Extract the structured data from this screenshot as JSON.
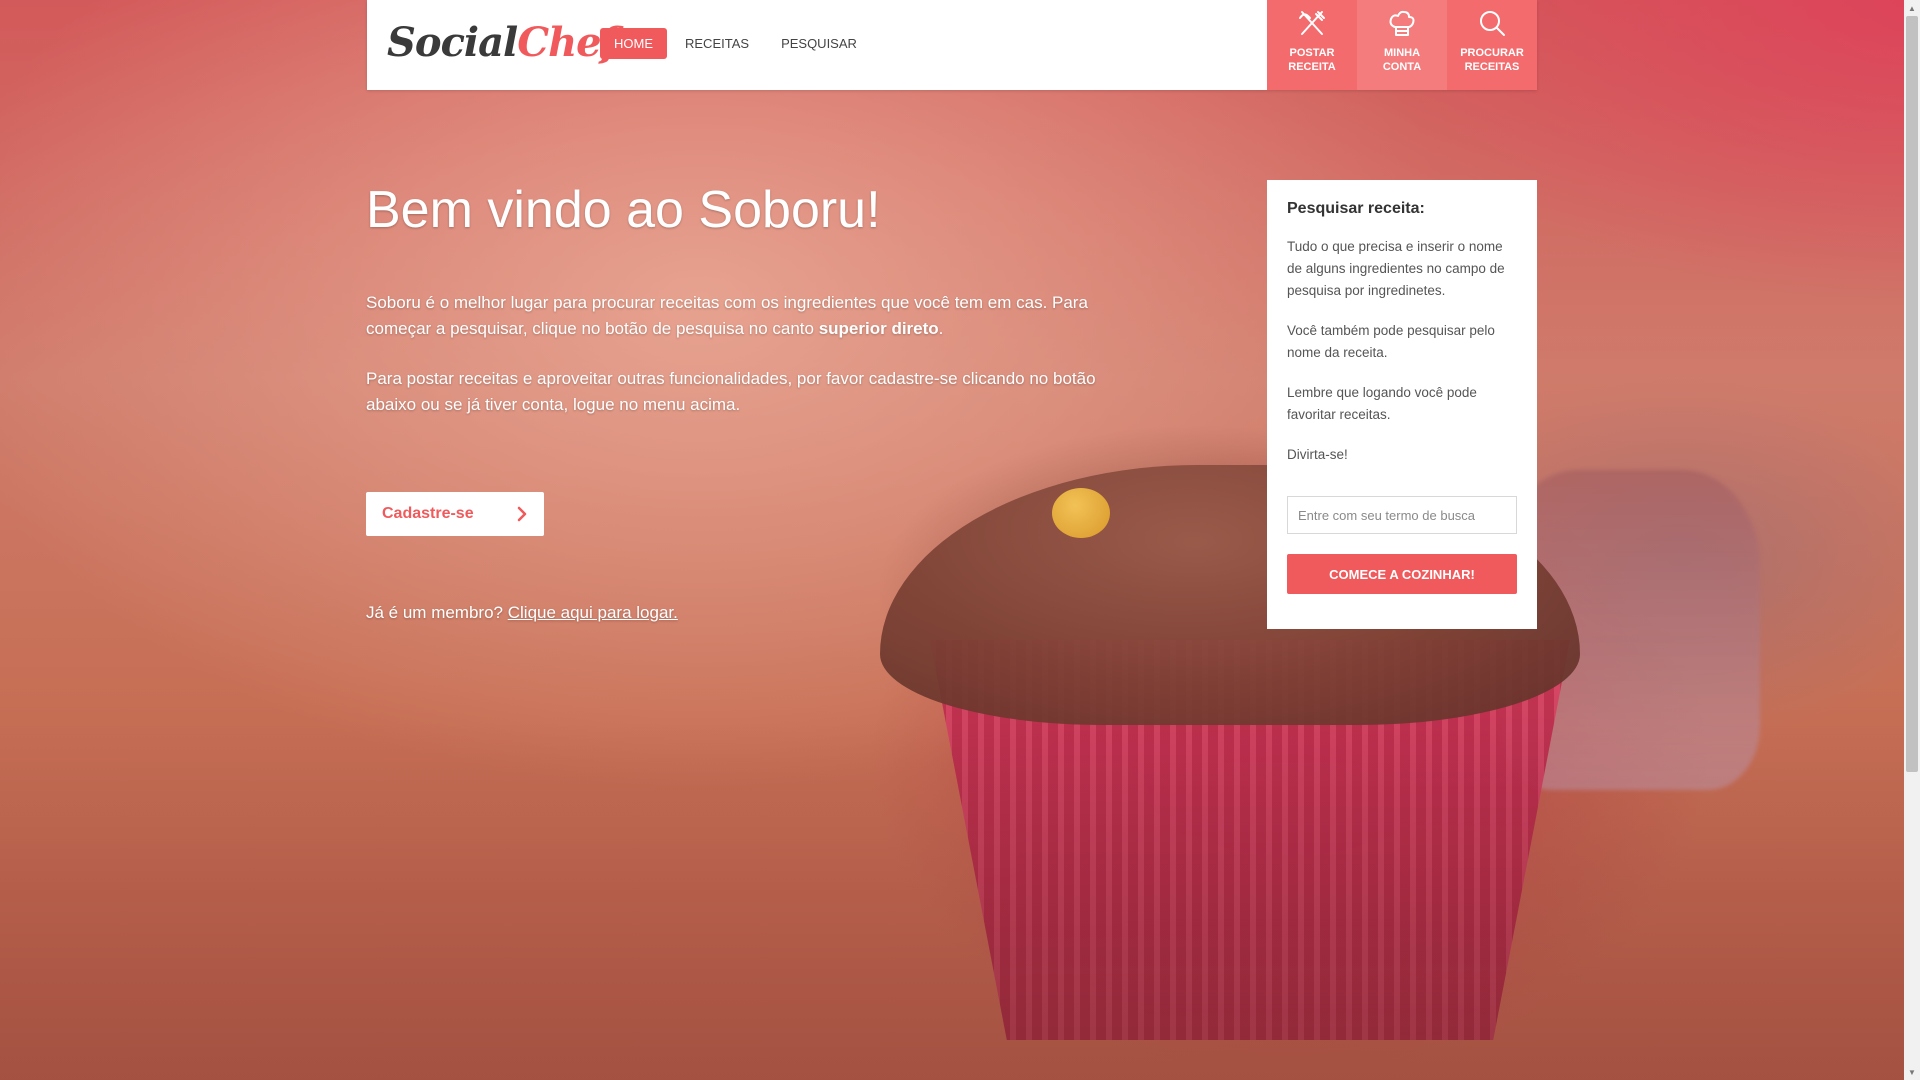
{
  "header": {
    "logo_part1": "Social",
    "logo_part2": "Chef",
    "nav": [
      {
        "label": "HOME",
        "active": true
      },
      {
        "label": "RECEITAS",
        "active": false
      },
      {
        "label": "PESQUISAR",
        "active": false
      }
    ],
    "quick_links": [
      {
        "icon": "fork-knife-icon",
        "line1": "POSTAR",
        "line2": "RECEITA"
      },
      {
        "icon": "chef-hat-icon",
        "line1": "MINHA",
        "line2": "CONTA"
      },
      {
        "icon": "search-icon",
        "line1": "PROCURAR",
        "line2": "RECEITAS"
      }
    ]
  },
  "hero": {
    "title": "Bem vindo ao Soboru!",
    "p1_start": "Soboru é o melhor lugar para procurar receitas com os ingredientes que você tem em cas. Para começar a pesquisar, clique no botão de pesquisa no canto ",
    "p1_bold": "superior direto",
    "p1_end": ".",
    "p2": "Para postar receitas e aproveitar outras funcionalidades, por favor cadastre-se clicando no botão abaixo ou se já tiver conta, logue no menu acima.",
    "signup_label": "Cadastre-se",
    "member_text": "Já é um membro? ",
    "login_link": "Clique aqui para logar."
  },
  "search_panel": {
    "title": "Pesquisar receita:",
    "p1": "Tudo o que precisa e inserir o nome de alguns ingredientes no campo de pesquisa por ingredinetes.",
    "p2": "Você também pode pesquisar pelo nome da receita.",
    "p3": "Lembre que logando você pode favoritar receitas.",
    "p4": "Divirta-se!",
    "input_placeholder": "Entre com seu termo de busca",
    "input_value": "",
    "button_label": "COMECE A COZINHAR!"
  },
  "colors": {
    "accent": "#f15a5c",
    "quick_bg": "#f36b6d"
  }
}
